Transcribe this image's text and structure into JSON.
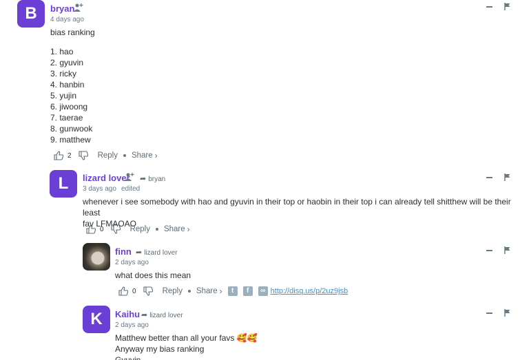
{
  "comments": [
    {
      "avatar_letter": "B",
      "author": "bryan",
      "time": "4 days ago",
      "lines": [
        "bias ranking",
        "",
        "1. hao",
        "2. gyuvin",
        "3. ricky",
        "4. hanbin",
        "5. yujin",
        "6. jiwoong",
        "7. taerae",
        "8. gunwook",
        "9. matthew"
      ],
      "likes": "2",
      "reply_label": "Reply",
      "share_label": "Share"
    },
    {
      "avatar_letter": "L",
      "author": "lizard lover",
      "reply_to": "bryan",
      "time": "3 days ago",
      "edited": "edited",
      "lines": [
        "whenever i see somebody with hao and gyuvin in their top or haobin in their top i can already tell shitthew will be their least",
        "fav LFMAOAO"
      ],
      "likes": "0",
      "reply_label": "Reply",
      "share_label": "Share"
    },
    {
      "author": "finn",
      "reply_to": "lizard lover",
      "time": "2 days ago",
      "lines": [
        "what does this mean"
      ],
      "likes": "0",
      "reply_label": "Reply",
      "share_label": "Share",
      "share_link": "http://disq.us/p/2uz9jsb"
    },
    {
      "avatar_letter": "K",
      "author": "Kaihu",
      "reply_to": "lizard lover",
      "time": "2 days ago",
      "lines": [
        "Matthew better than all your favs 🥰🥰",
        "Anyway my bias ranking",
        "Gyuvin"
      ]
    }
  ],
  "colors": {
    "accent": "#6b3fd6",
    "muted": "#687a86",
    "link": "#4a8fc0"
  },
  "icons": [
    "follow-icon",
    "reply-arrow-icon",
    "thumbs-up-icon",
    "thumbs-down-icon",
    "minimize-icon",
    "flag-icon",
    "twitter-icon",
    "facebook-icon",
    "link-icon"
  ]
}
